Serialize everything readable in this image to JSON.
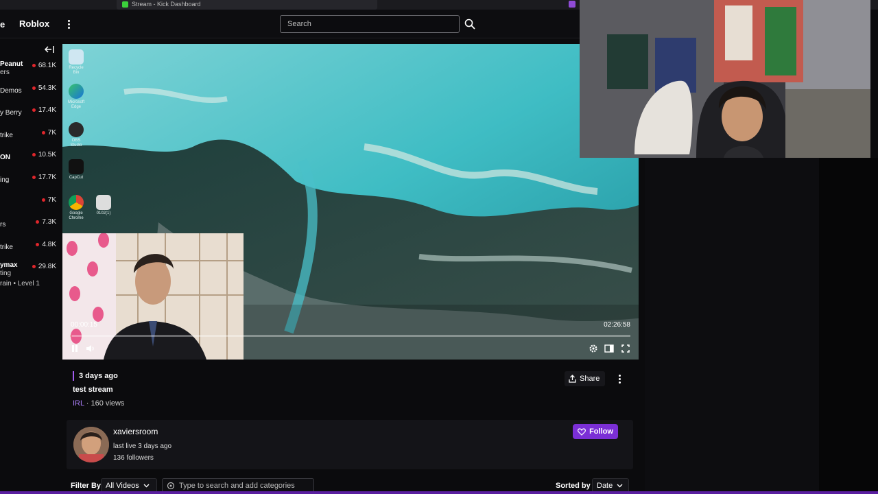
{
  "browser": {
    "tab_title": "Stream - Kick Dashboard"
  },
  "header": {
    "brand_partial": "e",
    "category": "Roblox",
    "search_placeholder": "Search"
  },
  "sidebar": {
    "items": [
      {
        "name": "Peanut",
        "sub": "ers",
        "count": "68.1K",
        "bold": true
      },
      {
        "name": "Demos",
        "sub": "",
        "count": "54.3K",
        "bold": false
      },
      {
        "name": "y Berry",
        "sub": "",
        "count": "17.4K",
        "bold": false
      },
      {
        "name": "trike",
        "sub": "",
        "count": "7K",
        "bold": false
      },
      {
        "name": "ON",
        "sub": "",
        "count": "10.5K",
        "bold": true
      },
      {
        "name": "ing",
        "sub": "",
        "count": "17.7K",
        "bold": false
      },
      {
        "name": "",
        "sub": "",
        "count": "7K",
        "bold": false
      },
      {
        "name": "rs",
        "sub": "",
        "count": "7.3K",
        "bold": false
      },
      {
        "name": "trike",
        "sub": "",
        "count": "4.8K",
        "bold": false
      },
      {
        "name": "ymax",
        "sub": "ting",
        "count": "29.8K",
        "bold": true
      }
    ],
    "footer_text": "rain • Level 1"
  },
  "player": {
    "current_time": "00:00:15",
    "total_time": "02:26:58",
    "progress": 0.0017,
    "desktop_icons": [
      "Recycle Bin",
      "Microsoft Edge",
      "OBS Studio",
      "CapCut",
      "Google Chrome",
      "0102(1)"
    ]
  },
  "video_info": {
    "date": "3 days ago",
    "title": "test stream",
    "category": "IRL",
    "views": " · 160 views",
    "share_label": "Share"
  },
  "channel": {
    "name": "xaviersroom",
    "last_live": "last live 3 days ago",
    "followers": "136 followers",
    "follow_label": "Follow"
  },
  "filters": {
    "filter_label": "Filter By",
    "filter_value": "All Videos",
    "category_placeholder": "Type to search and add categories",
    "sort_label": "Sorted by",
    "sort_value": "Date"
  },
  "colors": {
    "accent_purple": "#7b2fd6",
    "live_red": "#e0262b",
    "kick_green": "#3bd13b"
  }
}
